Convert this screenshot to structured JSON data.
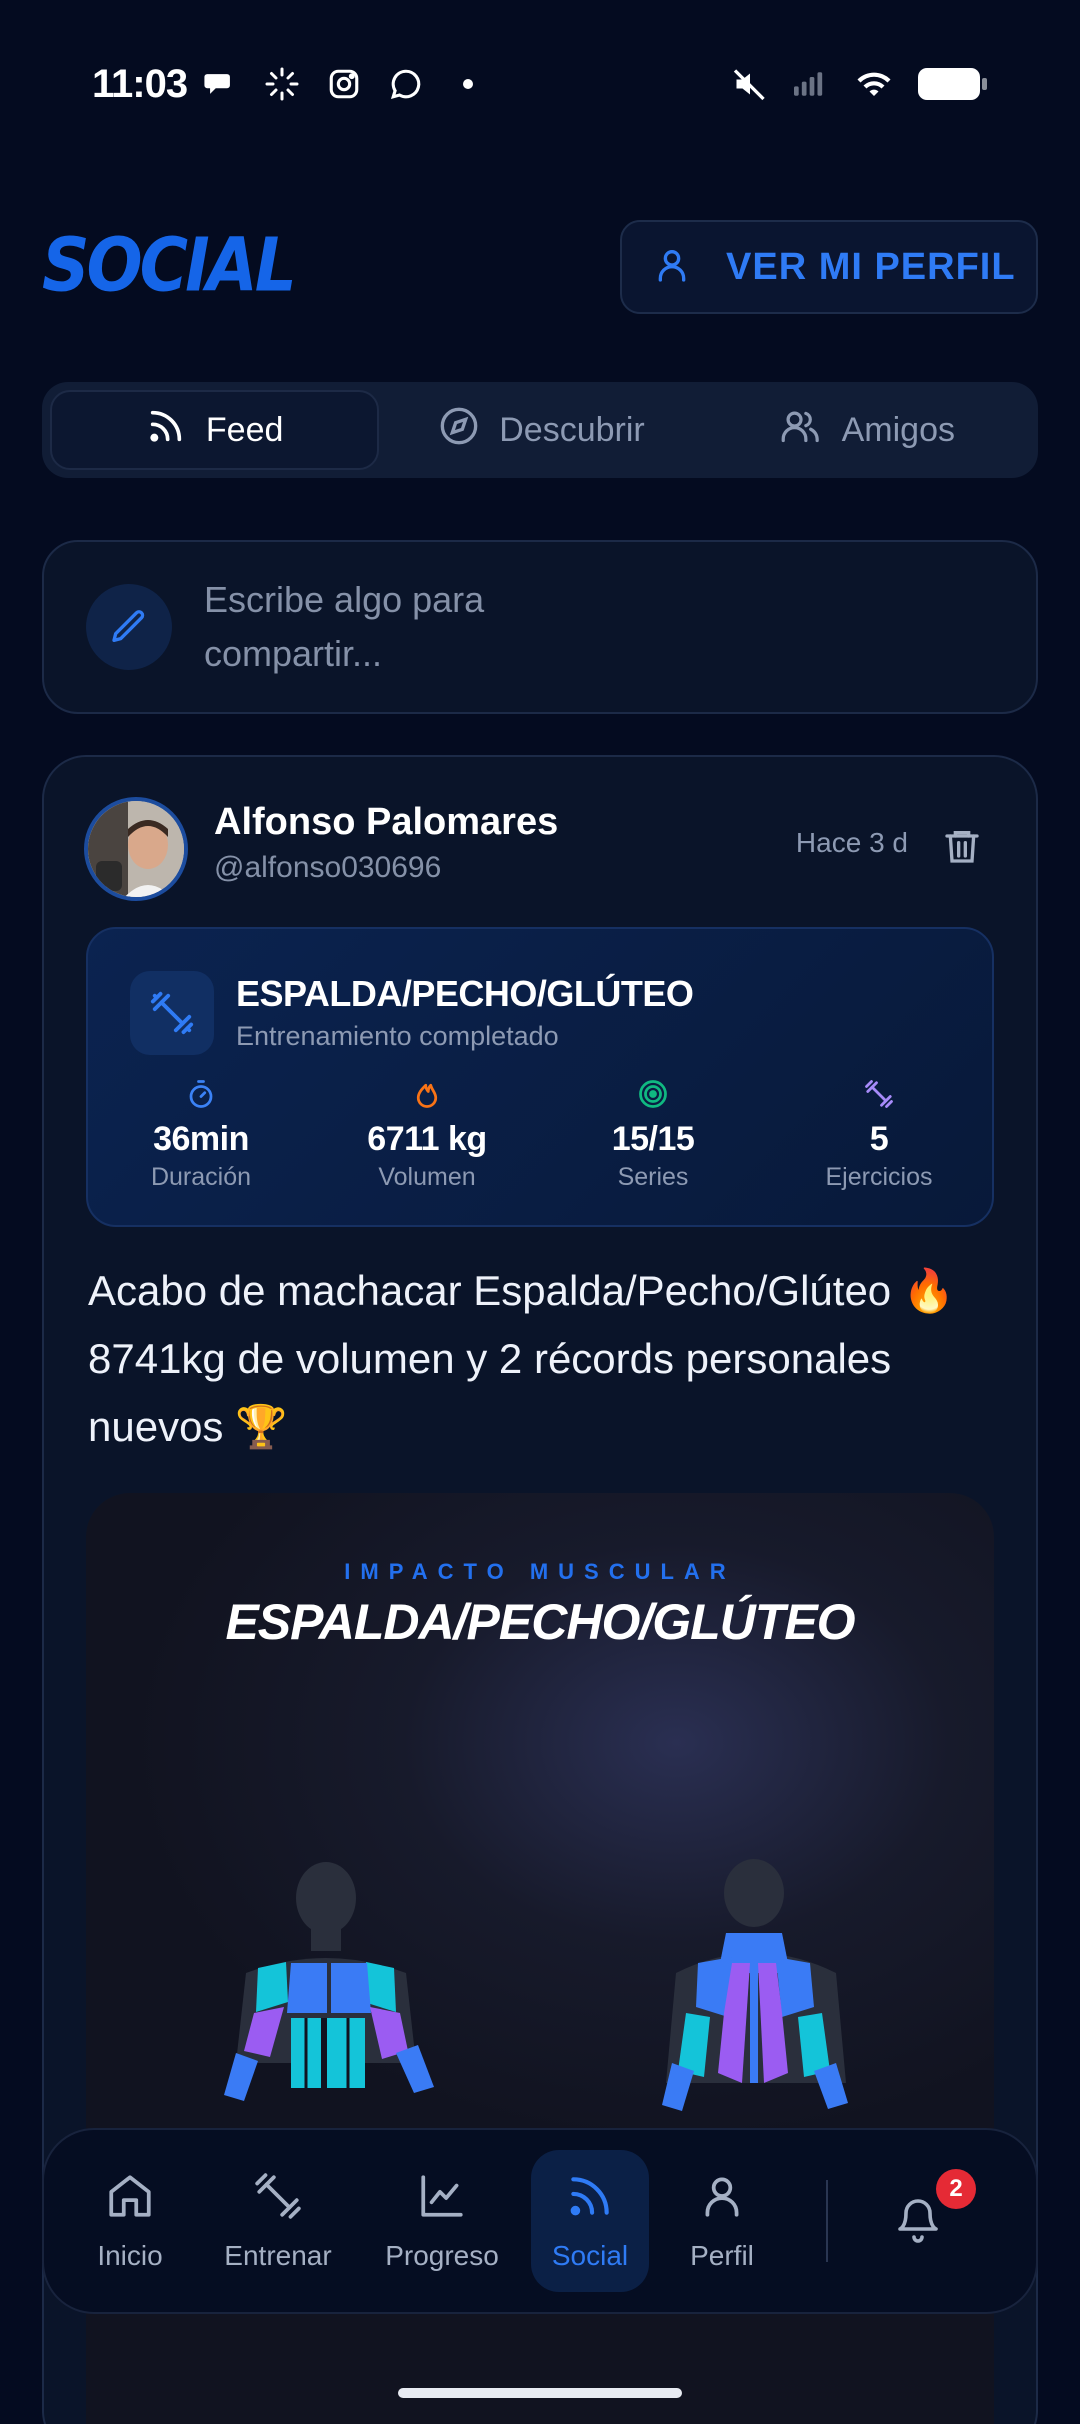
{
  "status_bar": {
    "time": "11:03"
  },
  "header": {
    "brand": "SOCIAL",
    "profile_button": "VER MI PERFIL"
  },
  "tabs": [
    {
      "label": "Feed",
      "icon": "rss-icon",
      "active": true
    },
    {
      "label": "Descubrir",
      "icon": "compass-icon",
      "active": false
    },
    {
      "label": "Amigos",
      "icon": "users-icon",
      "active": false
    }
  ],
  "composer": {
    "placeholder": "Escribe algo para compartir..."
  },
  "post": {
    "author": "Alfonso Palomares",
    "handle": "@alfonso030696",
    "time": "Hace 3 d",
    "workout": {
      "title": "ESPALDA/PECHO/GLÚTEO",
      "subtitle": "Entrenamiento completado",
      "stats": [
        {
          "value": "36min",
          "label": "Duración",
          "icon": "timer-icon",
          "color": "#3b82f6"
        },
        {
          "value": "6711 kg",
          "label": "Volumen",
          "icon": "flame-icon",
          "color": "#f97316"
        },
        {
          "value": "15/15",
          "label": "Series",
          "icon": "target-icon",
          "color": "#10b981"
        },
        {
          "value": "5",
          "label": "Ejercicios",
          "icon": "dumbbell-icon",
          "color": "#a78bfa"
        }
      ]
    },
    "text": "Acabo de machacar Espalda/Pecho/Glúteo 🔥 8741kg de volumen y 2 récords personales nuevos 🏆",
    "impact": {
      "kicker": "IMPACTO MUSCULAR",
      "title": "ESPALDA/PECHO/GLÚTEO"
    }
  },
  "bottom_nav": {
    "items": [
      {
        "label": "Inicio",
        "icon": "home-icon",
        "active": false
      },
      {
        "label": "Entrenar",
        "icon": "dumbbell-icon",
        "active": false
      },
      {
        "label": "Progreso",
        "icon": "chart-icon",
        "active": false
      },
      {
        "label": "Social",
        "icon": "rss-icon",
        "active": true
      },
      {
        "label": "Perfil",
        "icon": "user-icon",
        "active": false
      }
    ],
    "notifications_count": "2"
  },
  "colors": {
    "background": "#040b20",
    "accent": "#2f7bf5",
    "card": "#0a1429",
    "badge": "#e52a35"
  }
}
